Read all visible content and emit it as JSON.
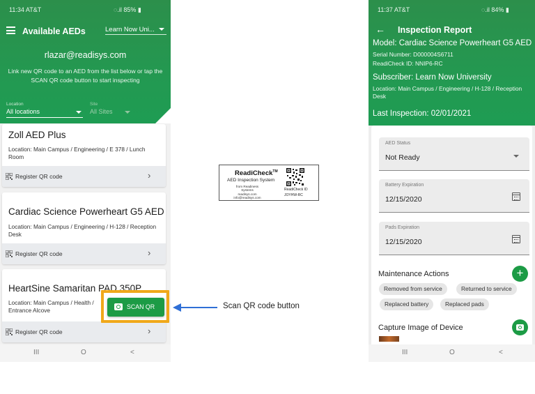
{
  "left_phone": {
    "status_time": "11:34 AT&T",
    "status_right": "85%",
    "title": "Available AEDs",
    "subscriber_select": "Learn Now Uni...",
    "email": "rlazar@readisys.com",
    "instruction": "Link new QR code to an AED from the list below or tap the SCAN QR code button to start inspecting",
    "location_label": "Location",
    "location_value": "All locations",
    "site_label": "Site",
    "site_value": "All Sites",
    "cards": [
      {
        "name": "Zoll AED Plus",
        "location": "Location: Main Campus / Engineering / E 378 / Lunch Room",
        "register": "Register QR code"
      },
      {
        "name": "Cardiac Science Powerheart G5 AED",
        "location": "Location: Main Campus / Engineering / H-128 / Reception Desk",
        "register": "Register QR code"
      },
      {
        "name": "HeartSine Samaritan PAD 350P",
        "location": "Location: Main Campus / Health / Entrance Alcove",
        "register": "Register QR code"
      }
    ],
    "scan_button": "SCAN QR",
    "nav": {
      "recents": "III",
      "home": "O",
      "back": "<"
    }
  },
  "qr_label": {
    "brand": "ReadiCheck",
    "trademark": "TM",
    "system": "AED Inspection System",
    "from": "from Readiness Systems",
    "site": "readisys.com",
    "email": "info@readisys.com",
    "id_label": "ReadiCheck ID",
    "id_value": "JOYHW-RC"
  },
  "callout": {
    "text": "Scan QR code button"
  },
  "right_phone": {
    "status_time": "11:37 AT&T",
    "status_right": "84%",
    "title": "Inspection Report",
    "model": "Model: Cardiac Science Powerheart G5 AED",
    "serial": "Serial Number: D000004S6711",
    "readicheck_id": "ReadiCheck ID: NNIP6-RC",
    "subscriber": "Subscriber: Learn Now University",
    "location": "Location: Main Campus / Engineering / H-128 / Reception Desk",
    "last_inspection": "Last Inspection: 02/01/2021",
    "fields": {
      "status_label": "AED Status",
      "status_value": "Not Ready",
      "battery_label": "Battery Expiration",
      "battery_value": "12/15/2020",
      "pads_label": "Pads Expiration",
      "pads_value": "12/15/2020"
    },
    "maintenance_title": "Maintenance Actions",
    "chips": [
      "Removed from service",
      "Returned to service",
      "Replaced battery",
      "Replaced pads"
    ],
    "capture_title": "Capture Image of Device",
    "nav": {
      "recents": "III",
      "home": "O",
      "back": "<"
    }
  },
  "colors": {
    "brand_green": "#229a52",
    "button_green": "#1c9b45",
    "highlight": "#f0a81a",
    "arrow": "#2f6fd6"
  }
}
